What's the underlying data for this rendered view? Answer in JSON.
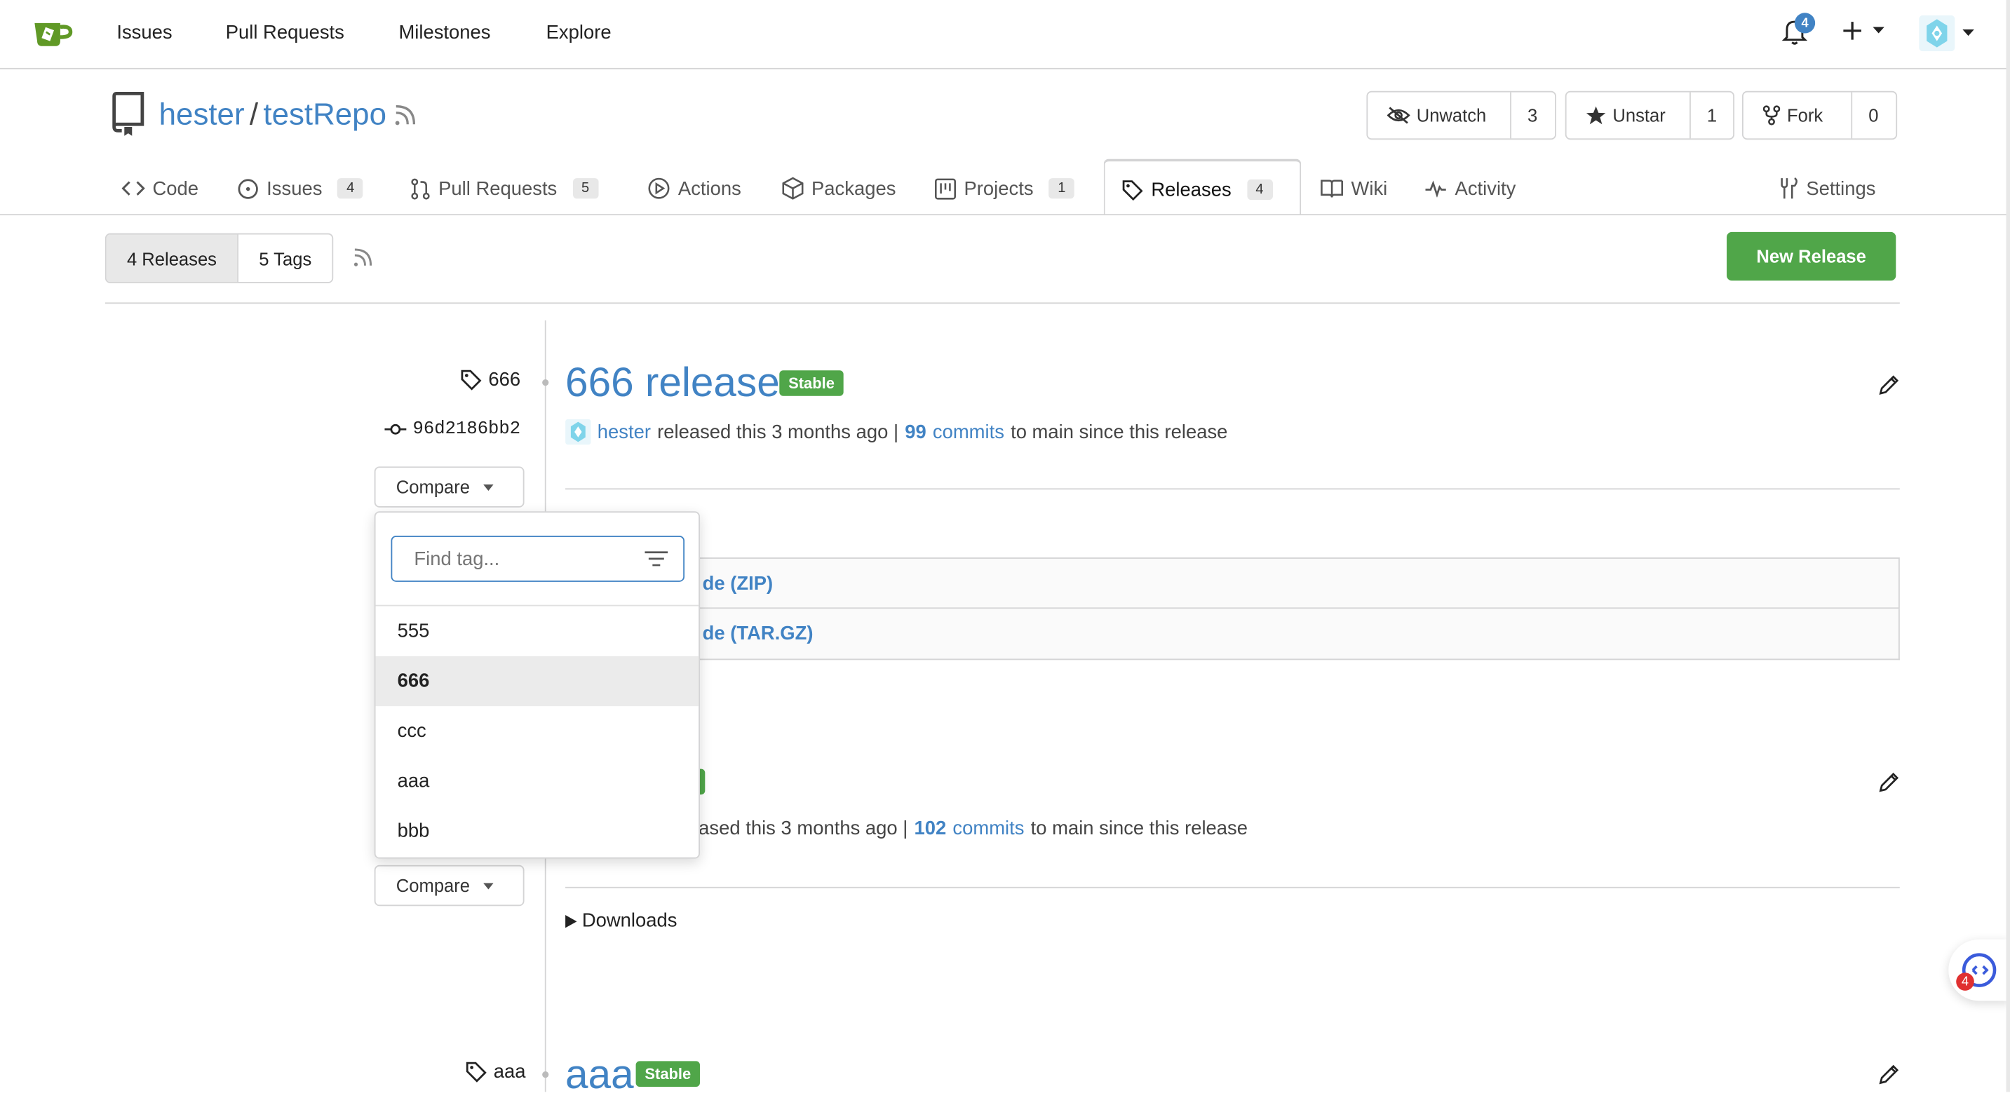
{
  "topnav": {
    "links": [
      "Issues",
      "Pull Requests",
      "Milestones",
      "Explore"
    ],
    "notifications_count": "4"
  },
  "repo": {
    "owner": "hester",
    "separator": "/",
    "name": "testRepo",
    "watch": {
      "label": "Unwatch",
      "count": "3"
    },
    "star": {
      "label": "Unstar",
      "count": "1"
    },
    "fork": {
      "label": "Fork",
      "count": "0"
    }
  },
  "tabs": [
    {
      "label": "Code",
      "icon": "code-icon"
    },
    {
      "label": "Issues",
      "icon": "issue-icon",
      "count": "4"
    },
    {
      "label": "Pull Requests",
      "icon": "pull-request-icon",
      "count": "5"
    },
    {
      "label": "Actions",
      "icon": "play-icon"
    },
    {
      "label": "Packages",
      "icon": "package-icon"
    },
    {
      "label": "Projects",
      "icon": "project-icon",
      "count": "1"
    },
    {
      "label": "Releases",
      "icon": "tag-icon",
      "count": "4",
      "active": true
    },
    {
      "label": "Wiki",
      "icon": "book-icon"
    },
    {
      "label": "Activity",
      "icon": "pulse-icon"
    },
    {
      "label": "Settings",
      "icon": "tools-icon"
    }
  ],
  "subheader": {
    "releases_label": "4 Releases",
    "tags_label": "5 Tags",
    "new_release": "New Release"
  },
  "releases": [
    {
      "tag": "666",
      "commit": "96d2186bb2",
      "title": "666 release",
      "badge": "Stable",
      "author": "hester",
      "released_text": "released this 3 months ago |",
      "commits_count": "99",
      "commits_word": "commits",
      "since_text": "to main since this release",
      "compare": "Compare",
      "downloads": [
        "de (ZIP)",
        "de (TAR.GZ)"
      ]
    },
    {
      "released_text": "ased this 3 months ago |",
      "commits_count": "102",
      "commits_word": "commits",
      "since_text": "to main since this release",
      "compare": "Compare",
      "downloads_label": "Downloads"
    },
    {
      "tag": "aaa",
      "title": "aaa",
      "badge": "Stable"
    }
  ],
  "compare_dropdown": {
    "placeholder": "Find tag...",
    "options": [
      "555",
      "666",
      "ccc",
      "aaa",
      "bbb"
    ],
    "selected": "666"
  },
  "floating_badge": "4",
  "colors": {
    "link": "#4183c4",
    "stable_badge": "#50a649",
    "new_release_button": "#50a649",
    "notification_badge": "#4183c4"
  }
}
